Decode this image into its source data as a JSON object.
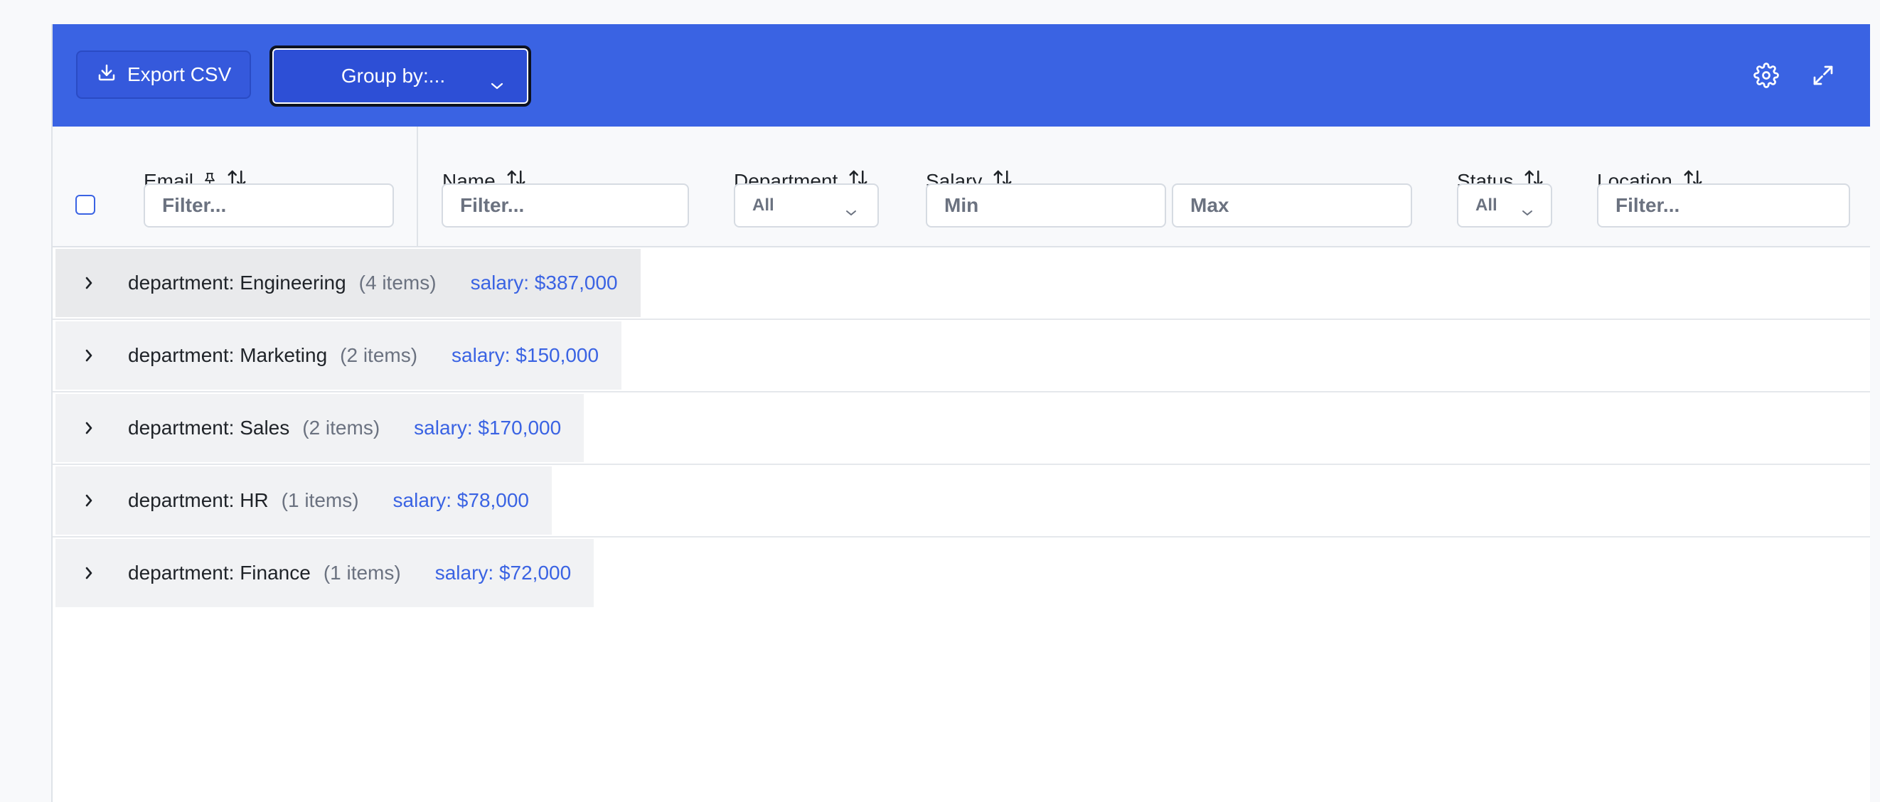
{
  "toolbar": {
    "export_label": "Export CSV",
    "group_by_label": "Group by:...",
    "export_icon": "download-icon",
    "settings_icon": "gear-icon",
    "fullscreen_icon": "expand-icon",
    "background_color": "#3a63e3"
  },
  "columns": {
    "email": {
      "title": "Email",
      "placeholder": "Filter..."
    },
    "name": {
      "title": "Name",
      "placeholder": "Filter..."
    },
    "department": {
      "title": "Department",
      "selected": "All"
    },
    "salary": {
      "title": "Salary",
      "min_placeholder": "Min",
      "max_placeholder": "Max"
    },
    "status": {
      "title": "Status",
      "selected": "All"
    },
    "location": {
      "title": "Location",
      "placeholder": "Filter..."
    }
  },
  "groups": [
    {
      "label": "department: Engineering",
      "count": "(4 items)",
      "sum": "salary: $387,000"
    },
    {
      "label": "department: Marketing",
      "count": "(2 items)",
      "sum": "salary: $150,000"
    },
    {
      "label": "department: Sales",
      "count": "(2 items)",
      "sum": "salary: $170,000"
    },
    {
      "label": "department: HR",
      "count": "(1 items)",
      "sum": "salary: $78,000"
    },
    {
      "label": "department: Finance",
      "count": "(1 items)",
      "sum": "salary: $72,000"
    }
  ]
}
